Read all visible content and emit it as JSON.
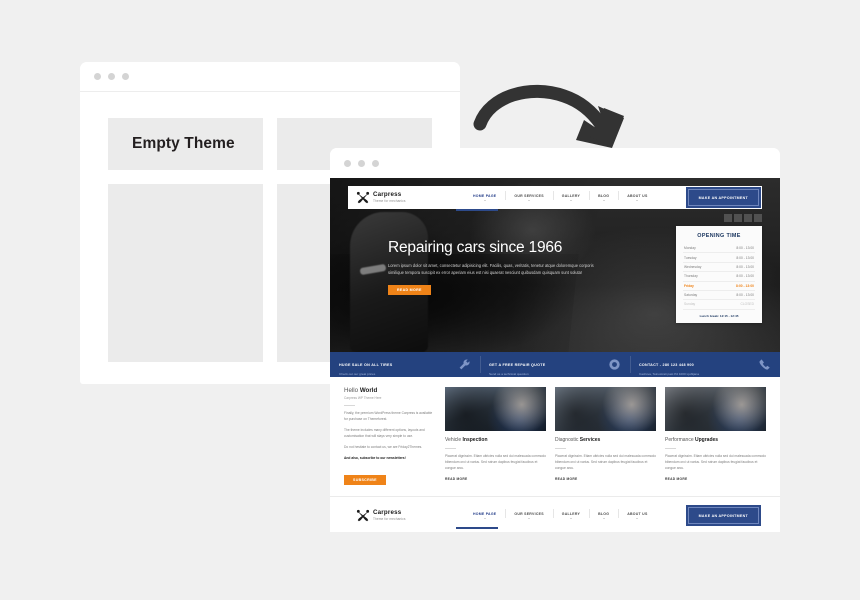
{
  "page": {
    "background": "#f0f0f0"
  },
  "arrow": {
    "name": "curved-arrow",
    "color": "#333333"
  },
  "left_window": {
    "title": "Empty Theme",
    "dots": [
      "dot-red",
      "dot-yellow",
      "dot-green"
    ],
    "placeholder_blocks": 4
  },
  "right_window": {
    "dots": [
      "dot-red",
      "dot-yellow",
      "dot-green"
    ],
    "nav": {
      "logo_name": "Carpress",
      "logo_tagline": "Theme for mechanics",
      "logo_icon": "wrench-screwdriver-icon",
      "menu": [
        {
          "label": "HOME PAGE",
          "active": true
        },
        {
          "label": "OUR SERVICES",
          "active": false
        },
        {
          "label": "GALLERY",
          "active": false
        },
        {
          "label": "BLOG",
          "active": false
        },
        {
          "label": "ABOUT US",
          "active": false
        }
      ],
      "cta": "MAKE AN APPOINTMENT"
    },
    "socials": [
      "facebook-icon",
      "twitter-icon",
      "google-plus-icon",
      "youtube-icon"
    ],
    "hero": {
      "heading": "Repairing cars since 1966",
      "paragraph": "Lorem ipsum dolor sit amet, consectetur adipisicing elit. Facilis, quas, veritatis, tenetur atque doloremque corporis similique tempora suscipit ex error aperiam eius est nisi quaerat nesciunt quibusdam quisquam sunt soluta!",
      "button": "READ MORE"
    },
    "opening": {
      "title": "OPENING TIME",
      "rows": [
        {
          "day": "Monday",
          "hours": "8:00 - 13:00",
          "state": "normal"
        },
        {
          "day": "Tuesday",
          "hours": "8:00 - 13:00",
          "state": "normal"
        },
        {
          "day": "Wednesday",
          "hours": "8:00 - 13:00",
          "state": "normal"
        },
        {
          "day": "Thursday",
          "hours": "8:00 - 13:00",
          "state": "normal"
        },
        {
          "day": "Friday",
          "hours": "8:00 - 13:00",
          "state": "highlight"
        },
        {
          "day": "Saturday",
          "hours": "8:00 - 13:00",
          "state": "normal"
        },
        {
          "day": "Sunday",
          "hours": "CLOSED",
          "state": "closed"
        }
      ],
      "footer": "Lunch break: 12:15 - 12:45"
    },
    "strip": [
      {
        "title": "HUGE SALE ON ALL TIRES",
        "sub": "Check out our great prices",
        "icon": "wrench-icon"
      },
      {
        "title": "GET A FREE REPAIR QUOTE",
        "sub": "Send us a technical question",
        "icon": "tire-icon"
      },
      {
        "title": "CONTACT - 280 123 448 900",
        "sub": "Cacilova, Teinostrati past Pd 1000 Ljubljana",
        "icon": "phone-icon"
      }
    ],
    "content": {
      "hello": {
        "title_light": "Hello ",
        "title_bold": "World",
        "subtitle": "Carpress WP Theme Here",
        "paragraphs": [
          "Finally, the premium WordPress theme Carpress is available for purchase on Themeforest.",
          "The theme includes many different options, layouts and customisation that will stays very simple to use.",
          "Do not hesitate to contact us, we are Friday2Themes."
        ],
        "cta_line": "And also, subscribe to our newsletters!",
        "button": "SUBSCRIBE"
      },
      "cards": [
        {
          "title_light": "Vehicle ",
          "title_bold": "Inspection",
          "image": "mechanic-with-car-photo",
          "text": "Placerat dignissim. Etiam ultricies nulla sed dui malesuada commodo bibendum orci ut varius. Sed rutrum dapibus feugiat faucibus et congue arcu.",
          "link": "READ MORE"
        },
        {
          "title_light": "Diagnostic ",
          "title_bold": "Services",
          "image": "mechanic-diagnostics-photo",
          "text": "Placerat dignissim. Etiam ultricies nulla sed dui malesuada commodo bibendum orci ut varius. Sed rutrum dapibus feugiat faucibus et congue arcu.",
          "link": "READ MORE"
        },
        {
          "title_light": "Performance ",
          "title_bold": "Upgrades",
          "image": "mechanic-engine-photo",
          "text": "Placerat dignissim. Etiam ultricies nulla sed dui malesuada commodo bibendum orci ut varius. Sed rutrum dapibus feugiat faucibus et congue arcu.",
          "link": "READ MORE"
        }
      ]
    },
    "footer_nav": {
      "logo_name": "Carpress",
      "logo_tagline": "Theme for mechanics",
      "menu": [
        {
          "label": "HOME PAGE",
          "active": true
        },
        {
          "label": "OUR SERVICES",
          "active": false
        },
        {
          "label": "GALLERY",
          "active": false
        },
        {
          "label": "BLOG",
          "active": false
        },
        {
          "label": "ABOUT US",
          "active": false
        }
      ],
      "cta": "MAKE AN APPOINTMENT"
    }
  },
  "colors": {
    "accent_orange": "#ef8318",
    "brand_blue": "#24427f",
    "nav_blue": "#2d4a8a",
    "page_bg": "#f0f0f0",
    "block_gray": "#ebebeb"
  }
}
